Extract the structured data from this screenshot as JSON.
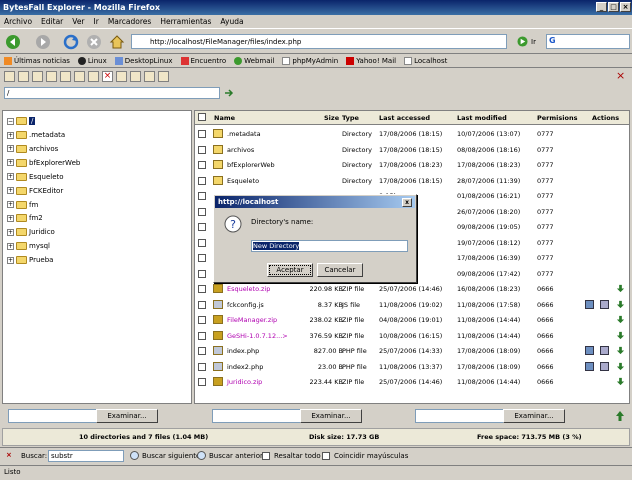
{
  "window": {
    "title": "BytesFall Explorer - Mozilla Firefox"
  },
  "menu": [
    "Archivo",
    "Editar",
    "Ver",
    "Ir",
    "Marcadores",
    "Herramientas",
    "Ayuda"
  ],
  "nav": {
    "url": "http://localhost/FileManager/files/index.php",
    "go_label": "Ir"
  },
  "bookmarks": [
    "Últimas noticias",
    "Linux",
    "DesktopLinux",
    "Encuentro",
    "Webmail",
    "phpMyAdmin",
    "Yahoo! Mail",
    "Localhost"
  ],
  "path": {
    "value": "/"
  },
  "tree": {
    "root": "/",
    "items": [
      ".metadata",
      "archivos",
      "bfExplorerWeb",
      "Esqueleto",
      "FCKEditor",
      "fm",
      "fm2",
      "Juridico",
      "mysql",
      "Prueba"
    ]
  },
  "table": {
    "headers": {
      "name": "Name",
      "size": "Size",
      "type": "Type",
      "accessed": "Last accessed",
      "modified": "Last modified",
      "permissions": "Permisions",
      "actions": "Actions"
    },
    "rows": [
      {
        "name": ".metadata",
        "size": "",
        "type": "Directory",
        "accessed": "17/08/2006 (18:15)",
        "modified": "10/07/2006 (13:07)",
        "perm": "0777",
        "kind": "dir"
      },
      {
        "name": "archivos",
        "size": "",
        "type": "Directory",
        "accessed": "17/08/2006 (18:15)",
        "modified": "08/08/2006 (18:16)",
        "perm": "0777",
        "kind": "dir"
      },
      {
        "name": "bfExplorerWeb",
        "size": "",
        "type": "Directory",
        "accessed": "17/08/2006 (18:23)",
        "modified": "17/08/2006 (18:23)",
        "perm": "0777",
        "kind": "dir"
      },
      {
        "name": "Esqueleto",
        "size": "",
        "type": "Directory",
        "accessed": "17/08/2006 (18:15)",
        "modified": "28/07/2006 (11:39)",
        "perm": "0777",
        "kind": "dir"
      },
      {
        "name": "",
        "size": "",
        "type": "",
        "accessed": "8:15)",
        "modified": "01/08/2006 (16:21)",
        "perm": "0777",
        "kind": "hidden"
      },
      {
        "name": "",
        "size": "",
        "type": "",
        "accessed": "8:15)",
        "modified": "26/07/2006 (18:20)",
        "perm": "0777",
        "kind": "hidden"
      },
      {
        "name": "",
        "size": "",
        "type": "",
        "accessed": "8:15)",
        "modified": "09/08/2006 (19:05)",
        "perm": "0777",
        "kind": "hidden"
      },
      {
        "name": "",
        "size": "",
        "type": "",
        "accessed": "8:15)",
        "modified": "19/07/2006 (18:12)",
        "perm": "0777",
        "kind": "hidden"
      },
      {
        "name": "",
        "size": "",
        "type": "",
        "accessed": "8:15)",
        "modified": "17/08/2006 (16:39)",
        "perm": "0777",
        "kind": "hidden"
      },
      {
        "name": "",
        "size": "",
        "type": "",
        "accessed": "8:15)",
        "modified": "09/08/2006 (17:42)",
        "perm": "0777",
        "kind": "hidden"
      },
      {
        "name": "Esqueleto.zip",
        "size": "220.98 KB",
        "type": "ZIP file",
        "accessed": "25/07/2006 (14:46)",
        "modified": "16/08/2006 (18:23)",
        "perm": "0666",
        "kind": "zip"
      },
      {
        "name": "fckconfig.js",
        "size": "8.37 KB",
        "type": "JS file",
        "accessed": "11/08/2006 (19:02)",
        "modified": "11/08/2006 (17:58)",
        "perm": "0666",
        "kind": "file"
      },
      {
        "name": "FileManager.zip",
        "size": "238.02 KB",
        "type": "ZIP file",
        "accessed": "04/08/2006 (19:01)",
        "modified": "11/08/2006 (14:44)",
        "perm": "0666",
        "kind": "zip"
      },
      {
        "name": "GeSHi-1.0.7.12...>",
        "size": "376.59 KB",
        "type": "ZIP file",
        "accessed": "10/08/2006 (16:15)",
        "modified": "11/08/2006 (14:44)",
        "perm": "0666",
        "kind": "zip"
      },
      {
        "name": "index.php",
        "size": "827.00  B",
        "type": "PHP file",
        "accessed": "25/07/2006 (14:33)",
        "modified": "17/08/2006 (18:09)",
        "perm": "0666",
        "kind": "file"
      },
      {
        "name": "index2.php",
        "size": "23.00  B",
        "type": "PHP file",
        "accessed": "11/08/2006 (13:37)",
        "modified": "17/08/2006 (18:09)",
        "perm": "0666",
        "kind": "file"
      },
      {
        "name": "Juridico.zip",
        "size": "223.44 KB",
        "type": "ZIP file",
        "accessed": "25/07/2006 (14:46)",
        "modified": "11/08/2006 (14:44)",
        "perm": "0666",
        "kind": "zip"
      }
    ]
  },
  "upload": {
    "button_label": "Examinar..."
  },
  "info": {
    "dirs": "10 directories and 7 files (1.04 MB)",
    "disk": "Disk size: 17.73 GB",
    "free": "Free space: 713.75 MB (3 %)"
  },
  "find": {
    "close": "×",
    "label": "Buscar:",
    "value": "substr",
    "next": "Buscar siguiente",
    "prev": "Buscar anterior",
    "highlight": "Resaltar todo",
    "match_case": "Coincidir mayúsculas"
  },
  "status": {
    "text": "Listo"
  },
  "dialog": {
    "title": "http://localhost",
    "close": "x",
    "prompt": "Directory's name:",
    "value": "New Directory",
    "ok": "Aceptar",
    "cancel": "Cancelar"
  }
}
